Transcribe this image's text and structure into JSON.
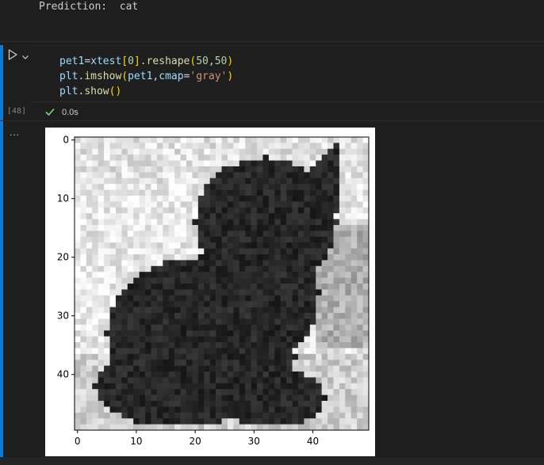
{
  "previous_output": {
    "label": "Prediction:",
    "value": "cat"
  },
  "cell": {
    "execution_count": "[48]",
    "status_time": "0.0s",
    "code": [
      {
        "tokens": [
          {
            "t": "pet1",
            "c": "tok-var"
          },
          {
            "t": "=",
            "c": "tok-punc"
          },
          {
            "t": "xtest",
            "c": "tok-var"
          },
          {
            "t": "[",
            "c": "tok-brace"
          },
          {
            "t": "0",
            "c": "tok-num"
          },
          {
            "t": "]",
            "c": "tok-brace"
          },
          {
            "t": ".",
            "c": "tok-punc"
          },
          {
            "t": "reshape",
            "c": "tok-fn"
          },
          {
            "t": "(",
            "c": "tok-brace"
          },
          {
            "t": "50",
            "c": "tok-num"
          },
          {
            "t": ",",
            "c": "tok-punc"
          },
          {
            "t": "50",
            "c": "tok-num"
          },
          {
            "t": ")",
            "c": "tok-brace"
          }
        ]
      },
      {
        "tokens": [
          {
            "t": "plt",
            "c": "tok-var"
          },
          {
            "t": ".",
            "c": "tok-punc"
          },
          {
            "t": "imshow",
            "c": "tok-fn"
          },
          {
            "t": "(",
            "c": "tok-brace"
          },
          {
            "t": "pet1",
            "c": "tok-var"
          },
          {
            "t": ",",
            "c": "tok-punc"
          },
          {
            "t": "cmap",
            "c": "tok-var"
          },
          {
            "t": "=",
            "c": "tok-punc"
          },
          {
            "t": "'gray'",
            "c": "tok-str"
          },
          {
            "t": ")",
            "c": "tok-brace"
          }
        ]
      },
      {
        "tokens": [
          {
            "t": "plt",
            "c": "tok-var"
          },
          {
            "t": ".",
            "c": "tok-punc"
          },
          {
            "t": "show",
            "c": "tok-fn"
          },
          {
            "t": "()",
            "c": "tok-brace"
          }
        ]
      }
    ]
  },
  "output_menu_label": "...",
  "chart_data": {
    "type": "heatmap",
    "colormap": "gray",
    "shape": [
      50,
      50
    ],
    "xlim": [
      0,
      49
    ],
    "ylim": [
      49,
      0
    ],
    "xticks": [
      0,
      10,
      20,
      30,
      40
    ],
    "yticks": [
      0,
      10,
      20,
      30,
      40
    ],
    "title": "",
    "xlabel": "",
    "ylabel": "",
    "content": "grayscale 50x50 pixel image of a dark cat sitting on a light background"
  },
  "colors": {
    "accent": "#0e7ad3",
    "success": "#89d185"
  },
  "icons": [
    "run-icon",
    "chevron-down-icon",
    "check-icon",
    "more-icon"
  ]
}
